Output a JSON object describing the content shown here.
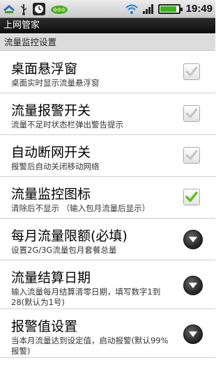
{
  "statusbar": {
    "time": "19:49",
    "battery_level": 0.85,
    "icons": [
      "sync-icon",
      "usb-icon",
      "alarm-clock-icon",
      "pea-app-icon",
      "wifi-icon",
      "signal-icon",
      "battery-icon"
    ]
  },
  "title": "上网管家",
  "section_header": "流量监控设置",
  "settings": [
    {
      "title": "桌面悬浮窗",
      "subtitle": "桌面实时显示流量悬浮窗",
      "control": "checkbox",
      "checked": false
    },
    {
      "title": "流量报警开关",
      "subtitle": "流量不足时状态栏弹出警告提示",
      "control": "checkbox",
      "checked": false
    },
    {
      "title": "自动断网开关",
      "subtitle": "报警后自动关闭移动网络",
      "control": "checkbox",
      "checked": false
    },
    {
      "title": "流量监控图标",
      "subtitle": "清除后不显示 （输入包月流量后显示）",
      "control": "checkbox",
      "checked": true
    },
    {
      "title": "每月流量限额(必填)",
      "subtitle": "设置2G/3G流量包月套餐总量",
      "control": "dropdown"
    },
    {
      "title": "流量结算日期",
      "subtitle": "输入流量每月结算清零日期，填写数字1到28(默认为1号)",
      "control": "dropdown"
    },
    {
      "title": "报警值设置",
      "subtitle": "当本月流量达到设定值，启动报警(默认99%报警)",
      "control": "dropdown"
    }
  ],
  "colors": {
    "check_green": "#5cc21f",
    "title_bar": "#1a1a1a",
    "section_bg": "#dcdcdc"
  }
}
